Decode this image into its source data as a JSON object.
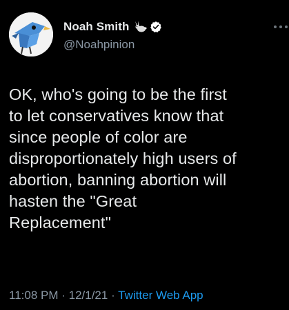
{
  "author": {
    "display_name": "Noah Smith",
    "handle": "@Noahpinion",
    "badge_icon": "rabbit-icon",
    "verified_icon": "verified-badge-icon",
    "verified_color": "#ffffff"
  },
  "tweet": {
    "text": "OK, who's going to be the first\nto let conservatives know that\nsince people of color are\ndisproportionately high users of\nabortion, banning abortion will\nhasten the \"Great\nReplacement\""
  },
  "meta": {
    "time": "11:08 PM",
    "separator1": " · ",
    "date": "12/1/21",
    "separator2": " · ",
    "source": "Twitter Web App"
  },
  "colors": {
    "background": "#000000",
    "text": "#e7e9ea",
    "secondary": "#8b98a5",
    "link": "#1d9bf0"
  }
}
